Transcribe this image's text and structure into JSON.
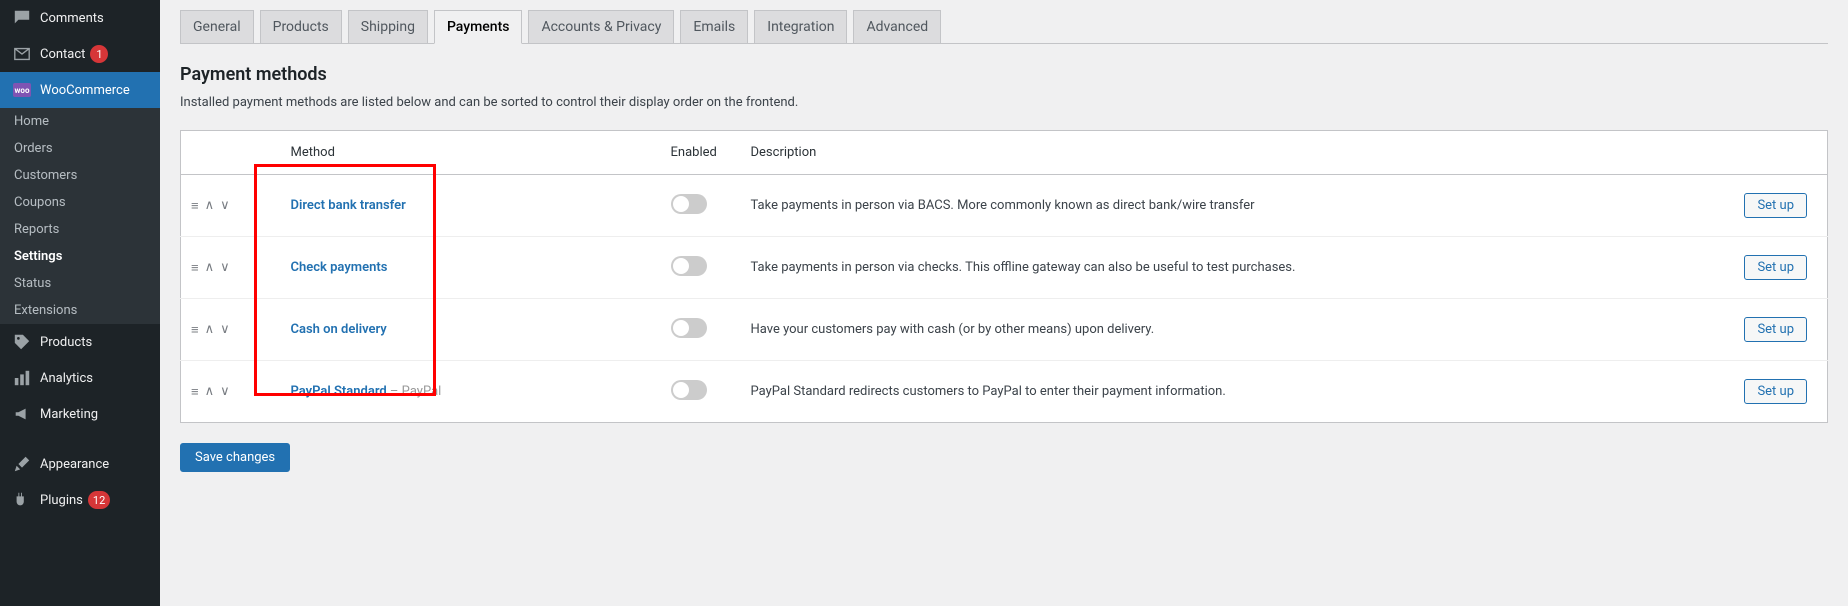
{
  "sidebar": {
    "comments": "Comments",
    "contact": "Contact",
    "contact_badge": "1",
    "woocommerce": "WooCommerce",
    "sub": {
      "home": "Home",
      "orders": "Orders",
      "customers": "Customers",
      "coupons": "Coupons",
      "reports": "Reports",
      "settings": "Settings",
      "status": "Status",
      "extensions": "Extensions"
    },
    "products": "Products",
    "analytics": "Analytics",
    "marketing": "Marketing",
    "appearance": "Appearance",
    "plugins": "Plugins",
    "plugins_badge": "12"
  },
  "tabs": {
    "general": "General",
    "products": "Products",
    "shipping": "Shipping",
    "payments": "Payments",
    "accounts": "Accounts & Privacy",
    "emails": "Emails",
    "integration": "Integration",
    "advanced": "Advanced"
  },
  "page": {
    "title": "Payment methods",
    "description": "Installed payment methods are listed below and can be sorted to control their display order on the frontend."
  },
  "table": {
    "headers": {
      "method": "Method",
      "enabled": "Enabled",
      "description": "Description"
    },
    "rows": [
      {
        "name": "Direct bank transfer",
        "suffix": "",
        "desc": "Take payments in person via BACS. More commonly known as direct bank/wire transfer",
        "btn": "Set up"
      },
      {
        "name": "Check payments",
        "suffix": "",
        "desc": "Take payments in person via checks. This offline gateway can also be useful to test purchases.",
        "btn": "Set up"
      },
      {
        "name": "Cash on delivery",
        "suffix": "",
        "desc": "Have your customers pay with cash (or by other means) upon delivery.",
        "btn": "Set up"
      },
      {
        "name": "PayPal Standard",
        "suffix": " – PayPal",
        "desc": "PayPal Standard redirects customers to PayPal to enter their payment information.",
        "btn": "Set up"
      }
    ]
  },
  "buttons": {
    "save": "Save changes"
  }
}
